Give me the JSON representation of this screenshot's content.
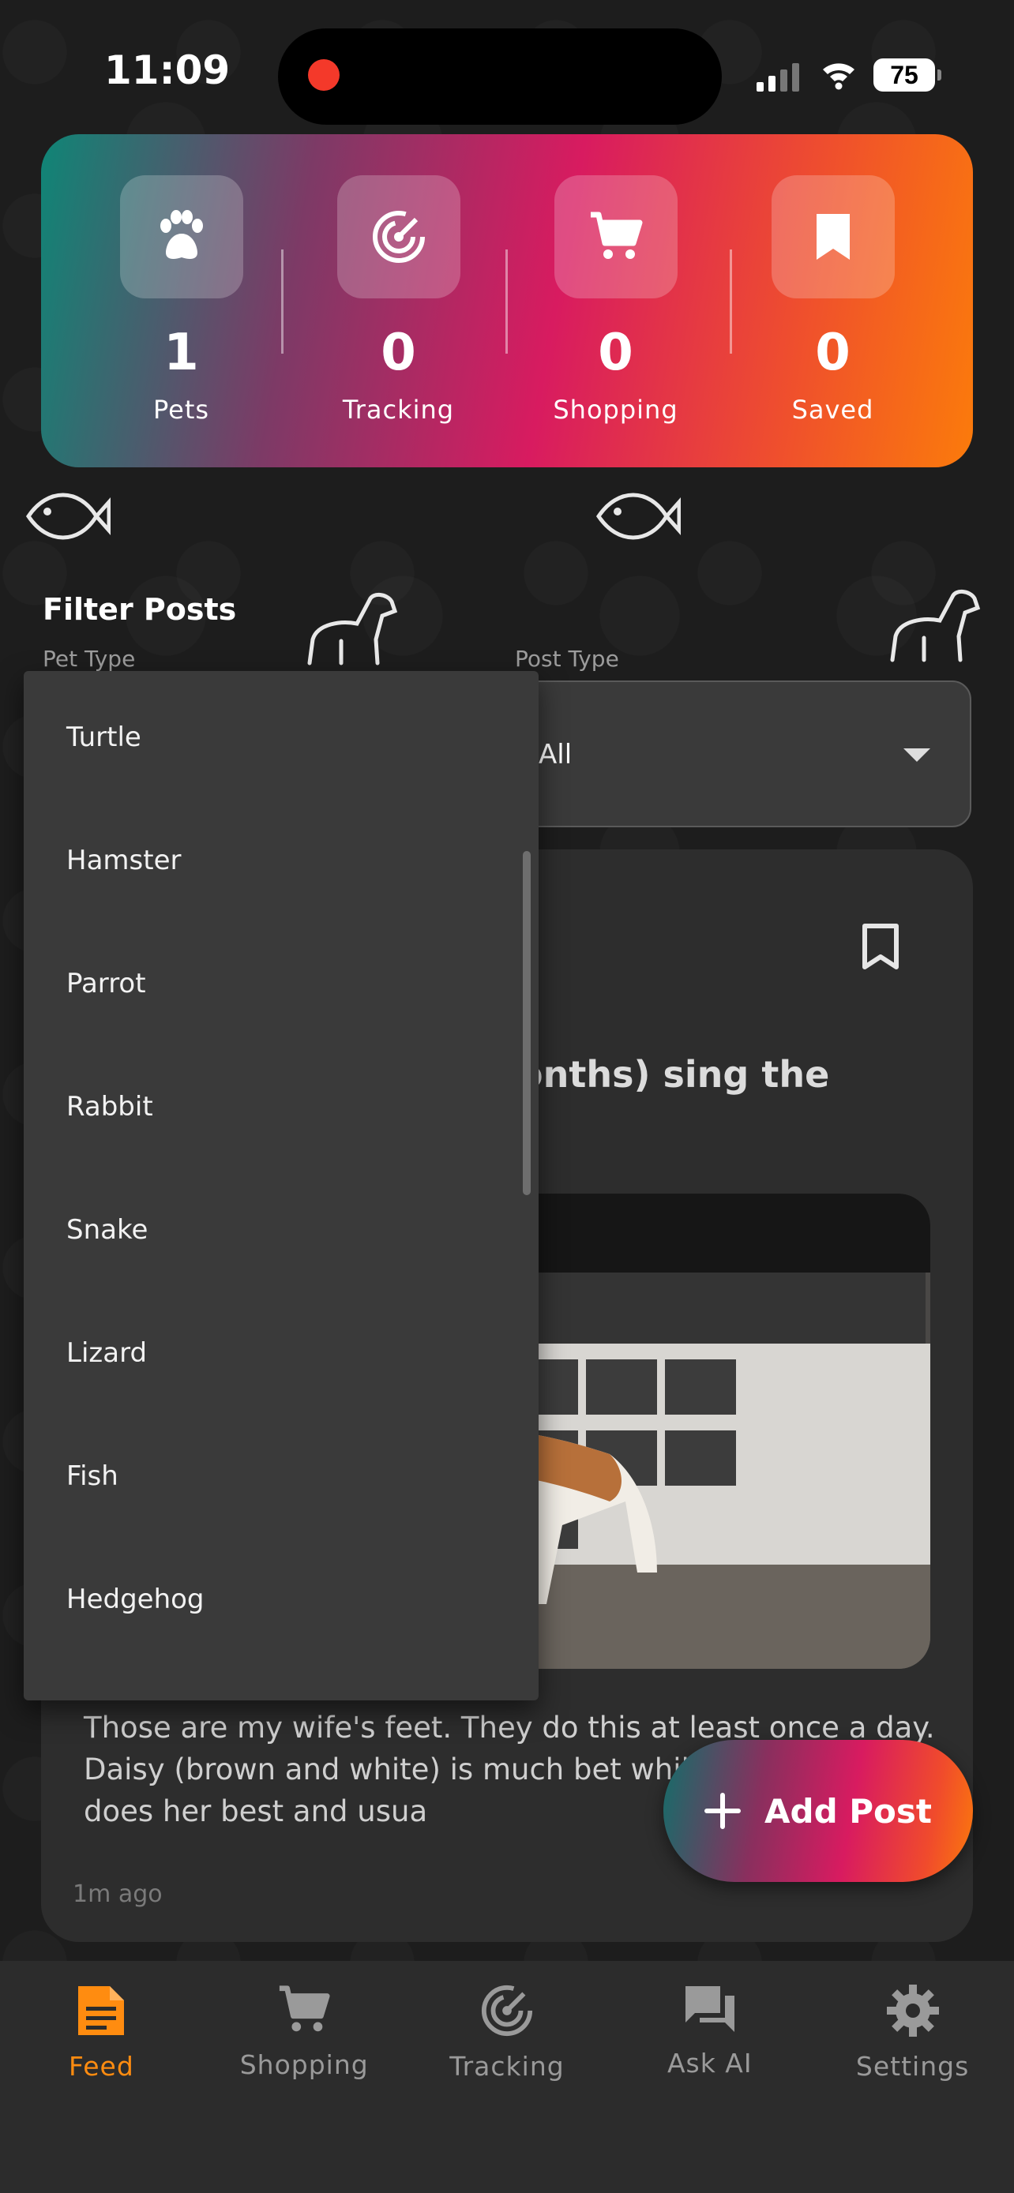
{
  "status_bar": {
    "time": "11:09",
    "battery": "75"
  },
  "stats": [
    {
      "icon": "paw-icon",
      "value": "1",
      "label": "Pets"
    },
    {
      "icon": "tracking-icon",
      "value": "0",
      "label": "Tracking"
    },
    {
      "icon": "cart-icon",
      "value": "0",
      "label": "Shopping"
    },
    {
      "icon": "bookmark-icon",
      "value": "0",
      "label": "Saved"
    }
  ],
  "filter": {
    "title": "Filter Posts",
    "pet_type_label": "Pet Type",
    "post_type_label": "Post Type",
    "post_type_value": "All",
    "pet_type_options": [
      "Turtle",
      "Hamster",
      "Parrot",
      "Rabbit",
      "Snake",
      "Lizard",
      "Fish",
      "Hedgehog"
    ]
  },
  "post": {
    "title_visible": "onths) sing the",
    "body": "Those are my wife's feet. They do this at least once a day. Daisy (brown and white) is much bet while Scone just does her best and usua",
    "time": "1m ago"
  },
  "fab": {
    "label": "Add Post"
  },
  "nav": [
    {
      "icon": "feed-icon",
      "label": "Feed",
      "active": true
    },
    {
      "icon": "cart-icon",
      "label": "Shopping",
      "active": false
    },
    {
      "icon": "tracking-icon",
      "label": "Tracking",
      "active": false
    },
    {
      "icon": "chat-icon",
      "label": "Ask AI",
      "active": false
    },
    {
      "icon": "gear-icon",
      "label": "Settings",
      "active": false
    }
  ],
  "colors": {
    "accent": "#ff8c10",
    "background": "#1e1e1e",
    "card": "#2d2d2d"
  }
}
